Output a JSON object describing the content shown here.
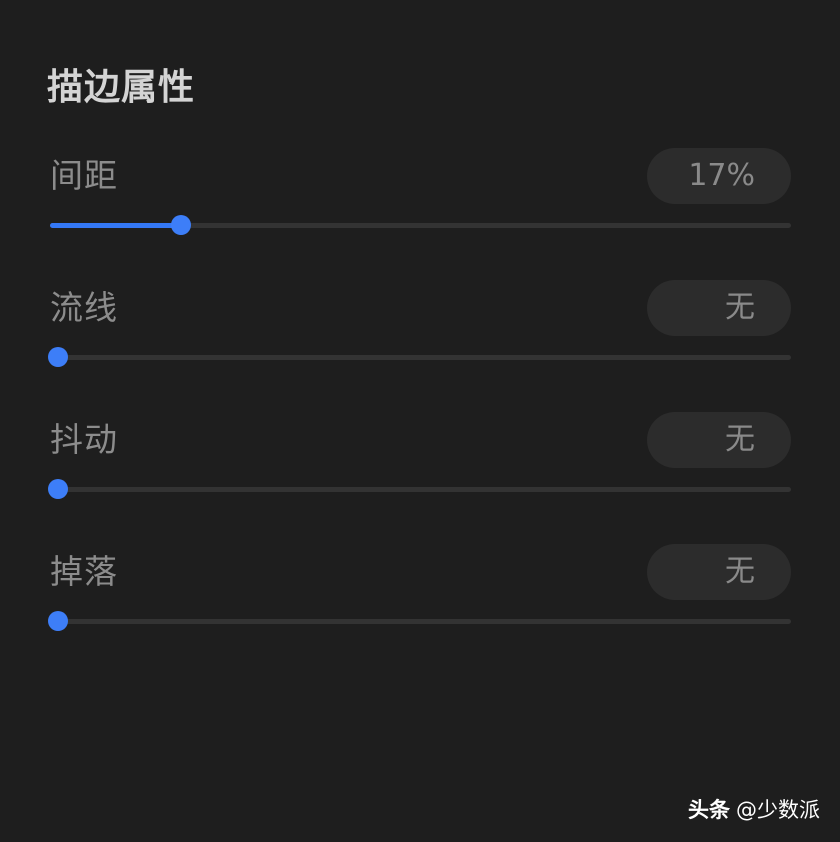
{
  "panel": {
    "title": "描边属性",
    "sliders": [
      {
        "label": "间距",
        "value_text": "17%",
        "fraction": 0.17
      },
      {
        "label": "流线",
        "value_text": "无",
        "fraction": 0
      },
      {
        "label": "抖动",
        "value_text": "无",
        "fraction": 0
      },
      {
        "label": "掉落",
        "value_text": "无",
        "fraction": 0
      }
    ]
  },
  "watermark": {
    "brand": "头条",
    "handle": "@少数派"
  },
  "colors": {
    "background": "#1e1e1e",
    "accent": "#3478f6",
    "track": "#333333",
    "pill": "#2c2c2c"
  }
}
